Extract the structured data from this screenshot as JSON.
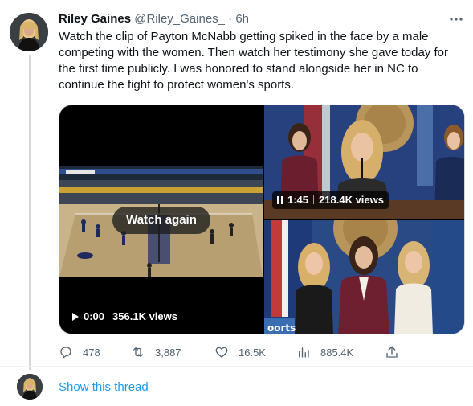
{
  "tweet": {
    "author_name": "Riley Gaines",
    "handle": "@Riley_Gaines_",
    "separator": "·",
    "time": "6h",
    "more_icon": "ellipsis-icon",
    "text_lines": [
      "Watch the clip of Payton McNabb getting spiked in the face by a male",
      "competing with the women. Then watch her testimony she gave today for",
      "the first time publicly. I was honored to stand alongside her in NC to",
      "continue the fight to protect women's sports."
    ]
  },
  "media": {
    "video_left": {
      "overlay_label": "Watch again",
      "time": "0:00",
      "views": "356.1K views",
      "icon": "play-icon"
    },
    "video_right_top": {
      "time": "1:45",
      "views": "218.4K views",
      "icon": "pause-icon"
    },
    "photo_right_bottom": {
      "icon": "photo"
    }
  },
  "actions": {
    "reply": {
      "count": "478",
      "icon": "reply-icon"
    },
    "retweet": {
      "count": "3,887",
      "icon": "retweet-icon"
    },
    "like": {
      "count": "16.5K",
      "icon": "heart-icon"
    },
    "views": {
      "count": "885.4K",
      "icon": "analytics-icon"
    },
    "share": {
      "icon": "share-icon"
    }
  },
  "thread": {
    "show_label": "Show this thread"
  },
  "colors": {
    "link": "#1d9bf0",
    "secondary_text": "#536471",
    "primary_text": "#0f1419",
    "border": "#cfd9de"
  }
}
